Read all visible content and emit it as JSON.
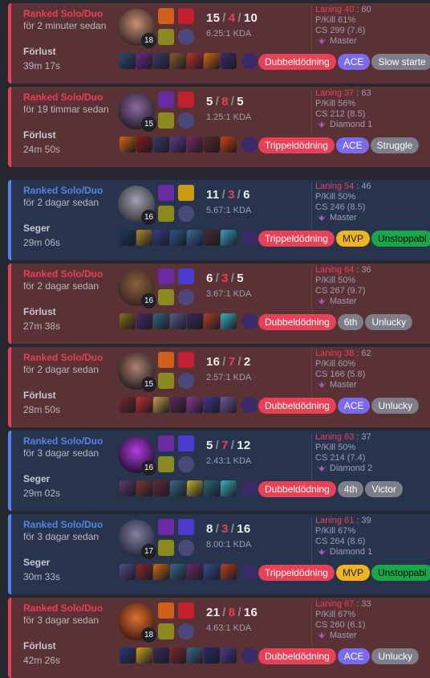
{
  "games": [
    {
      "result_type": "loss",
      "queue": "Ranked Solo/Duo",
      "time": "för 2 minuter sedan",
      "result": "Förlust",
      "duration": "39m 17s",
      "level": "18",
      "kills": "15",
      "deaths": "4",
      "assists": "10",
      "kda": "6.25:1 KDA",
      "laning_label": "Laning 40",
      "laning_opp": "60",
      "pkill": "P/Kill 61%",
      "cs": "CS 299 (7.6)",
      "tier": "Master",
      "tags": [
        {
          "text": "Dubbeldödning",
          "color": "red"
        },
        {
          "text": "ACE",
          "color": "purple"
        },
        {
          "text": "Slow starte",
          "color": "gray"
        }
      ]
    },
    {
      "result_type": "loss",
      "queue": "Ranked Solo/Duo",
      "time": "för 19 timmar sedan",
      "result": "Förlust",
      "duration": "24m 50s",
      "level": "15",
      "kills": "5",
      "deaths": "8",
      "assists": "5",
      "kda": "1.25:1 KDA",
      "laning_label": "Laning 37",
      "laning_opp": "63",
      "pkill": "P/Kill 56%",
      "cs": "CS 212 (8.5)",
      "tier": "Diamond 1",
      "tags": [
        {
          "text": "Trippeldödning",
          "color": "red"
        },
        {
          "text": "ACE",
          "color": "purple"
        },
        {
          "text": "Struggle",
          "color": "gray"
        }
      ]
    },
    {
      "result_type": "win",
      "queue": "Ranked Solo/Duo",
      "time": "för 2 dagar sedan",
      "result": "Seger",
      "duration": "29m 06s",
      "level": "16",
      "kills": "11",
      "deaths": "3",
      "assists": "6",
      "kda": "5.67:1 KDA",
      "laning_label": "Laning 54",
      "laning_opp": "46",
      "pkill": "P/Kill 50%",
      "cs": "CS 246 (8.5)",
      "tier": "Master",
      "tags": [
        {
          "text": "Trippeldödning",
          "color": "red"
        },
        {
          "text": "MVP",
          "color": "mvp"
        },
        {
          "text": "Unstoppabl",
          "color": "unstop"
        }
      ]
    },
    {
      "result_type": "loss",
      "queue": "Ranked Solo/Duo",
      "time": "för 2 dagar sedan",
      "result": "Förlust",
      "duration": "27m 38s",
      "level": "16",
      "kills": "6",
      "deaths": "3",
      "assists": "5",
      "kda": "3.67:1 KDA",
      "laning_label": "Laning 64",
      "laning_opp": "36",
      "pkill": "P/Kill 50%",
      "cs": "CS 267 (9.7)",
      "tier": "Master",
      "tags": [
        {
          "text": "Dubbeldödning",
          "color": "red"
        },
        {
          "text": "6th",
          "color": "gray"
        },
        {
          "text": "Unlucky",
          "color": "gray"
        }
      ]
    },
    {
      "result_type": "loss",
      "queue": "Ranked Solo/Duo",
      "time": "för 2 dagar sedan",
      "result": "Förlust",
      "duration": "28m 50s",
      "level": "15",
      "kills": "16",
      "deaths": "7",
      "assists": "2",
      "kda": "2.57:1 KDA",
      "laning_label": "Laning 38",
      "laning_opp": "62",
      "pkill": "P/Kill 60%",
      "cs": "CS 166 (5.8)",
      "tier": "Master",
      "tags": [
        {
          "text": "Dubbeldödning",
          "color": "red"
        },
        {
          "text": "ACE",
          "color": "purple"
        },
        {
          "text": "Unlucky",
          "color": "gray"
        }
      ]
    },
    {
      "result_type": "win",
      "queue": "Ranked Solo/Duo",
      "time": "för 3 dagar sedan",
      "result": "Seger",
      "duration": "29m 02s",
      "level": "16",
      "kills": "5",
      "deaths": "7",
      "assists": "12",
      "kda": "2.43:1 KDA",
      "laning_label": "Laning 63",
      "laning_opp": "37",
      "pkill": "P/Kill 50%",
      "cs": "CS 214 (7.4)",
      "tier": "Diamond 2",
      "tags": [
        {
          "text": "Dubbeldödning",
          "color": "red"
        },
        {
          "text": "4th",
          "color": "gray"
        },
        {
          "text": "Victor",
          "color": "gray"
        }
      ]
    },
    {
      "result_type": "win",
      "queue": "Ranked Solo/Duo",
      "time": "för 3 dagar sedan",
      "result": "Seger",
      "duration": "30m 33s",
      "level": "17",
      "kills": "8",
      "deaths": "3",
      "assists": "16",
      "kda": "8.00:1 KDA",
      "laning_label": "Laning 61",
      "laning_opp": "39",
      "pkill": "P/Kill 67%",
      "cs": "CS 264 (8.6)",
      "tier": "Diamond 1",
      "tags": [
        {
          "text": "Trippeldödning",
          "color": "red"
        },
        {
          "text": "MVP",
          "color": "mvp"
        },
        {
          "text": "Unstoppabl",
          "color": "unstop"
        }
      ]
    },
    {
      "result_type": "loss",
      "queue": "Ranked Solo/Duo",
      "time": "för 3 dagar sedan",
      "result": "Förlust",
      "duration": "42m 26s",
      "level": "18",
      "kills": "21",
      "deaths": "8",
      "assists": "16",
      "kda": "4.63:1 KDA",
      "laning_label": "Laning 67",
      "laning_opp": "33",
      "pkill": "P/Kill 67%",
      "cs": "CS 260 (6.1)",
      "tier": "Master",
      "tags": [
        {
          "text": "Dubbeldödning",
          "color": "red"
        },
        {
          "text": "ACE",
          "color": "purple"
        },
        {
          "text": "Unlucky",
          "color": "gray"
        }
      ]
    }
  ],
  "labels": {
    "sep": "/",
    "colon": ":"
  }
}
